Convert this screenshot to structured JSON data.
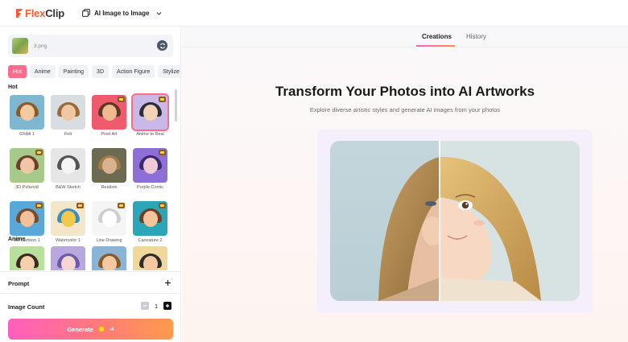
{
  "app": {
    "logo_a": "Flex",
    "logo_b": "Clip",
    "tool_name": "AI Image to Image"
  },
  "upload": {
    "file_name": "3.png"
  },
  "style_tabs": [
    "Hot",
    "Anime",
    "Painting",
    "3D",
    "Action Figure",
    "Stylize"
  ],
  "sections": {
    "hot_label": "Hot",
    "anime_label": "Anime"
  },
  "hot_styles": [
    {
      "label": "Ghibli 1",
      "premium": false,
      "bg": "#7fb6d0",
      "hair": "#8a5a2b",
      "face": "#f2c9a0"
    },
    {
      "label": "Felt",
      "premium": false,
      "bg": "#d8dde2",
      "hair": "#9b6b3a",
      "face": "#f1c6a2"
    },
    {
      "label": "Pixel Art",
      "premium": true,
      "bg": "#ef5a6d",
      "hair": "#5a3b22",
      "face": "#f0b98f"
    },
    {
      "label": "Anime to Real",
      "premium": true,
      "bg": "#c9b8e8",
      "hair": "#2d2d3a",
      "face": "#f3d2b6"
    },
    {
      "label": "3D Polaroid",
      "premium": true,
      "bg": "#a7c98a",
      "hair": "#6b3f2a",
      "face": "#f2c6a4"
    },
    {
      "label": "B&W Sketch",
      "premium": false,
      "bg": "#e6e6e6",
      "hair": "#555555",
      "face": "#f5f5f5"
    },
    {
      "label": "Realism",
      "premium": false,
      "bg": "#6d6a52",
      "hair": "#a37a4a",
      "face": "#d9b38d"
    },
    {
      "label": "Purple Comic",
      "premium": true,
      "bg": "#8e6fd6",
      "hair": "#3b2a6b",
      "face": "#f0c9d6"
    },
    {
      "label": "3D Cartoon 1",
      "premium": true,
      "bg": "#5aa8d8",
      "hair": "#7a4a2a",
      "face": "#f2c09a"
    },
    {
      "label": "Watercolor 1",
      "premium": true,
      "bg": "#f3e6c9",
      "hair": "#3b8fbf",
      "face": "#f2c94c"
    },
    {
      "label": "Line Drawing",
      "premium": true,
      "bg": "#f5f5f5",
      "hair": "#cfcfcf",
      "face": "#ffffff"
    },
    {
      "label": "Caricature 2",
      "premium": true,
      "bg": "#2aa6b8",
      "hair": "#6b3f2a",
      "face": "#f4c59a"
    }
  ],
  "anime_styles": [
    {
      "label": "",
      "bg": "#b8e09a",
      "hair": "#3b2a1e",
      "face": "#f5cfae"
    },
    {
      "label": "",
      "bg": "#b9a8e0",
      "hair": "#6b5aa8",
      "face": "#f6d6cf"
    },
    {
      "label": "",
      "bg": "#8ab4d6",
      "hair": "#8a5a2b",
      "face": "#f3c9a2"
    },
    {
      "label": "",
      "bg": "#f0d79a",
      "hair": "#2d2d2d",
      "face": "#f4c9a0"
    }
  ],
  "prompt": {
    "label": "Prompt"
  },
  "image_count": {
    "label": "Image Count",
    "value": "1"
  },
  "generate": {
    "label": "Generate",
    "cost": "-4"
  },
  "main_tabs": {
    "creations": "Creations",
    "history": "History"
  },
  "hero": {
    "title": "Transform Your Photos into AI Artworks",
    "subtitle": "Explore diverse artistic styles and generate AI images from your photos"
  },
  "colors": {
    "accent_pink": "#ff6b8b",
    "accent_orange": "#ff9b4a"
  }
}
